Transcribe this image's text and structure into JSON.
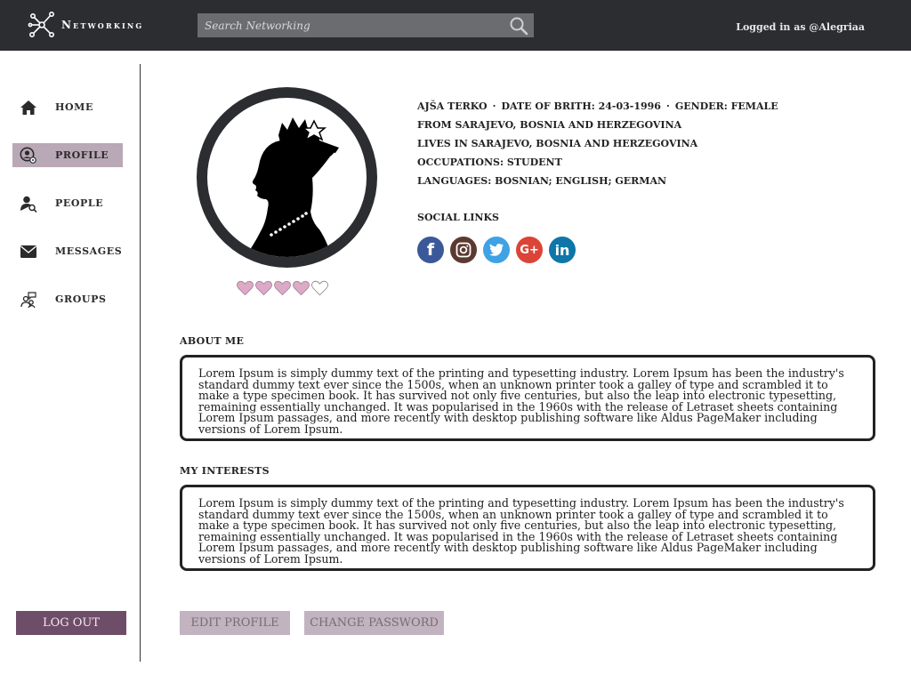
{
  "header": {
    "app_name": "Networking",
    "search_placeholder": "Search Networking",
    "search_value": "",
    "login_status": "Logged in as @Alegriaa"
  },
  "sidebar": {
    "items": [
      {
        "label": "HOME",
        "icon": "home-icon",
        "active": false
      },
      {
        "label": "PROFILE",
        "icon": "profile-settings-icon",
        "active": true
      },
      {
        "label": "PEOPLE",
        "icon": "people-search-icon",
        "active": false
      },
      {
        "label": "MESSAGES",
        "icon": "envelope-icon",
        "active": false
      },
      {
        "label": "GROUPS",
        "icon": "groups-icon",
        "active": false
      }
    ],
    "logout_label": "LOG OUT"
  },
  "profile": {
    "avatar": "queen-silhouette-avatar",
    "rating": {
      "filled": 4,
      "total": 5
    },
    "name": "AJŠA TERKO",
    "dob": "DATE OF BRITH: 24-03-1996",
    "gender": "GENDER: FEMALE",
    "separator": "·",
    "from": "FROM SARAJEVO, BOSNIA AND HERZEGOVINA",
    "lives": "LIVES IN SARAJEVO, BOSNIA AND HERZEGOVINA",
    "occupation": "OCCUPATIONS: STUDENT",
    "languages": "LANGUAGES: BOSNIAN; ENGLISH; GERMAN",
    "social_title": "SOCIAL LINKS",
    "social_links": [
      {
        "name": "facebook-icon",
        "glyph": "f",
        "color": "#3b5998"
      },
      {
        "name": "instagram-icon",
        "glyph": "",
        "color": "#5b3a32"
      },
      {
        "name": "twitter-icon",
        "glyph": "",
        "color": "#3ea2e4"
      },
      {
        "name": "google-plus-icon",
        "glyph": "G+",
        "color": "#db4437"
      },
      {
        "name": "linkedin-icon",
        "glyph": "in",
        "color": "#0e76a8"
      }
    ]
  },
  "about": {
    "title": "ABOUT ME",
    "text": "Lorem Ipsum is simply dummy text of the printing and typesetting industry. Lorem Ipsum has been the industry's standard dummy text ever since the 1500s, when an unknown printer took a galley of type and scrambled it to make a type specimen book. It has survived not only five centuries, but also the leap into electronic typesetting, remaining essentially unchanged. It was popularised in the 1960s with the release of Letraset sheets containing Lorem Ipsum passages, and more recently with desktop publishing software like Aldus PageMaker including versions of Lorem Ipsum."
  },
  "interests": {
    "title": "MY INTERESTS",
    "text": "Lorem Ipsum is simply dummy text of the printing and typesetting industry. Lorem Ipsum has been the industry's standard dummy text ever since the 1500s, when an unknown printer took a galley of type and scrambled it to make a type specimen book. It has survived not only five centuries, but also the leap into electronic typesetting, remaining essentially unchanged. It was popularised in the 1960s with the release of Letraset sheets containing Lorem Ipsum passages, and more recently with desktop publishing software like Aldus PageMaker including versions of Lorem Ipsum."
  },
  "actions": {
    "edit_label": "EDIT PROFILE",
    "change_password_label": "CHANGE PASSWORD"
  },
  "colors": {
    "topbar": "#2b2d31",
    "active_nav": "#b9a8b5",
    "logout": "#6e4d68",
    "secondary_button": "#c2b3c0",
    "heart": "#d9a6c2"
  }
}
